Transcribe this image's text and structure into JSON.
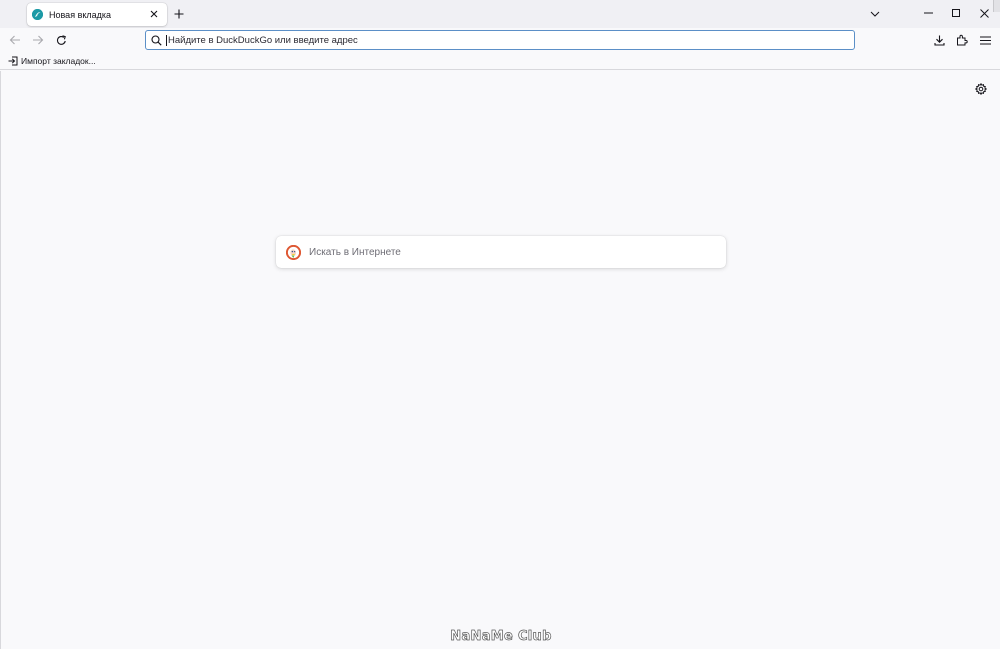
{
  "tab": {
    "title": "Новая вкладка",
    "favicon": "firefox-icon"
  },
  "urlbar": {
    "placeholder": "Найдите в DuckDuckGo или введите адрес",
    "value": ""
  },
  "bookmarks": {
    "items": [
      {
        "label": "Импорт закладок...",
        "icon": "import-icon"
      }
    ]
  },
  "content": {
    "search_placeholder": "Искать в Интернете",
    "search_engine_icon": "duckduckgo-icon"
  },
  "watermark": "NaNaMe Club",
  "colors": {
    "tabstrip_bg": "#f0f0f4",
    "page_bg": "#f9f9fb",
    "urlbar_focus": "#5b8fc7",
    "duckduckgo": "#de5833"
  }
}
